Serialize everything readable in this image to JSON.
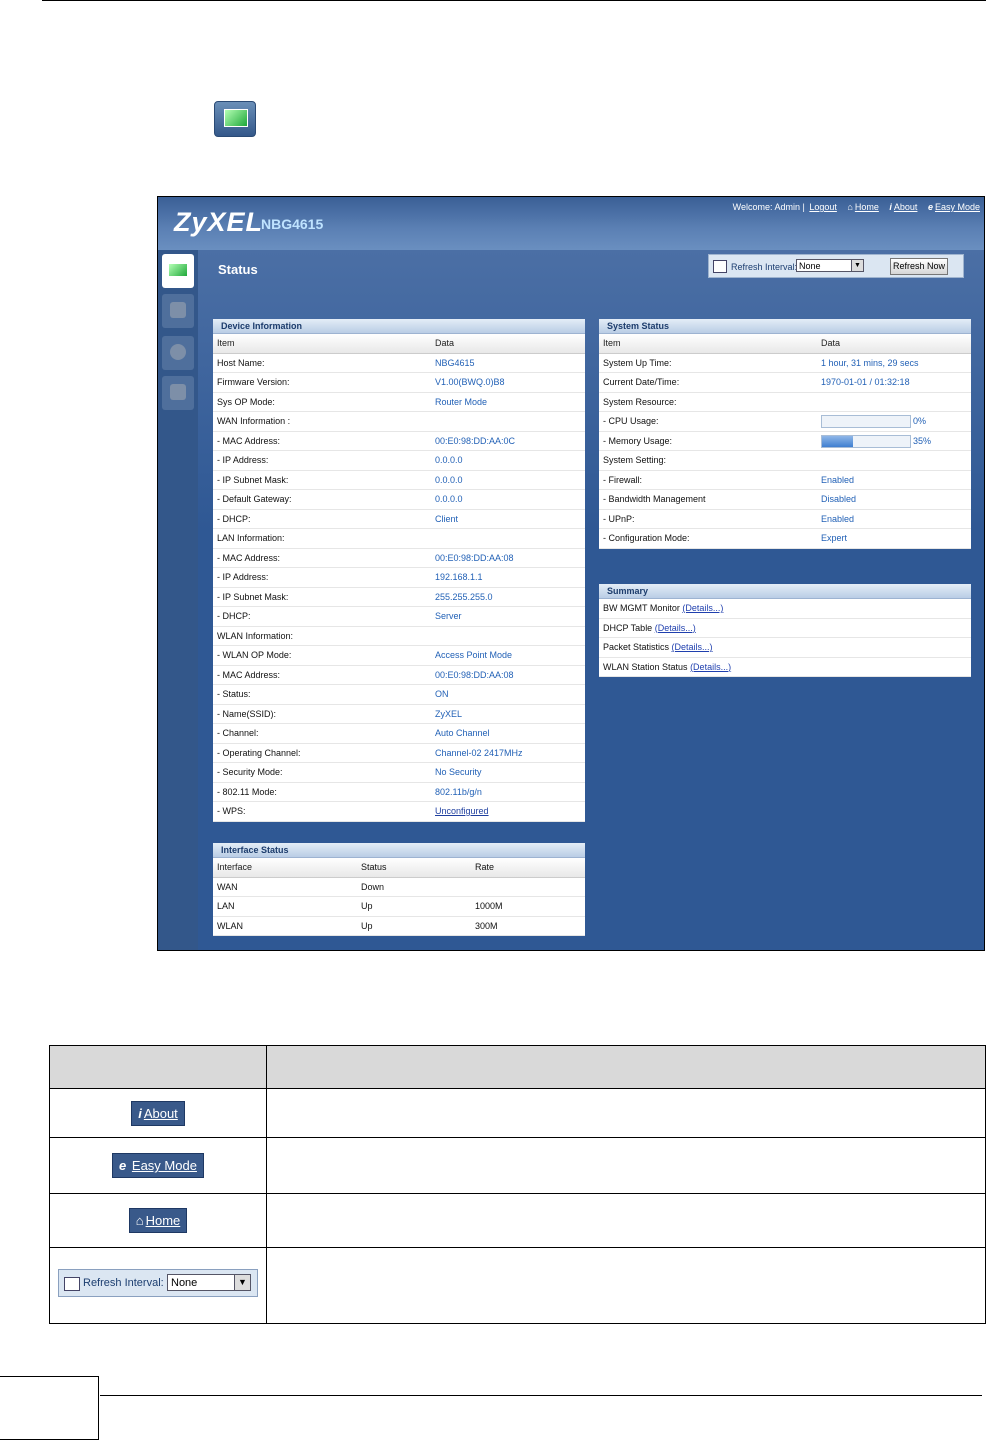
{
  "header": {
    "logo": "ZyXEL",
    "model": "NBG4615",
    "welcome": "Welcome: Admin |",
    "logout": "Logout",
    "home": "Home",
    "about": "About",
    "easy_mode": "Easy Mode"
  },
  "page": {
    "title": "Status",
    "refresh_label": "Refresh Interval:",
    "refresh_value": "None",
    "refresh_button": "Refresh Now"
  },
  "device_info": {
    "title": "Device Information",
    "col_item": "Item",
    "col_data": "Data",
    "rows": [
      {
        "item": "Host Name:",
        "data": "NBG4615"
      },
      {
        "item": "Firmware Version:",
        "data": "V1.00(BWQ.0)B8"
      },
      {
        "item": "Sys OP Mode:",
        "data": "Router Mode"
      },
      {
        "item": "WAN Information :",
        "data": ""
      },
      {
        "item": "- MAC Address:",
        "data": "00:E0:98:DD:AA:0C"
      },
      {
        "item": "- IP Address:",
        "data": "0.0.0.0"
      },
      {
        "item": "- IP Subnet Mask:",
        "data": "0.0.0.0"
      },
      {
        "item": "- Default Gateway:",
        "data": "0.0.0.0"
      },
      {
        "item": "- DHCP:",
        "data": "Client"
      },
      {
        "item": "LAN Information:",
        "data": ""
      },
      {
        "item": "- MAC Address:",
        "data": "00:E0:98:DD:AA:08"
      },
      {
        "item": "- IP Address:",
        "data": "192.168.1.1"
      },
      {
        "item": "- IP Subnet Mask:",
        "data": "255.255.255.0"
      },
      {
        "item": "- DHCP:",
        "data": "Server"
      },
      {
        "item": "WLAN Information:",
        "data": ""
      },
      {
        "item": "- WLAN OP Mode:",
        "data": "Access Point Mode"
      },
      {
        "item": "- MAC Address:",
        "data": "00:E0:98:DD:AA:08"
      },
      {
        "item": "- Status:",
        "data": "ON"
      },
      {
        "item": "- Name(SSID):",
        "data": "ZyXEL"
      },
      {
        "item": "- Channel:",
        "data": "Auto Channel"
      },
      {
        "item": "- Operating Channel:",
        "data": "Channel-02 2417MHz"
      },
      {
        "item": "- Security Mode:",
        "data": "No Security"
      },
      {
        "item": "- 802.11 Mode:",
        "data": "802.11b/g/n"
      },
      {
        "item": "- WPS:",
        "data": "Unconfigured"
      }
    ]
  },
  "system_status": {
    "title": "System Status",
    "col_item": "Item",
    "col_data": "Data",
    "up_time_label": "System Up Time:",
    "up_time": "1 hour, 31 mins, 29 secs",
    "date_label": "Current Date/Time:",
    "date": "1970-01-01 / 01:32:18",
    "resource_label": "System Resource:",
    "cpu_label": "- CPU Usage:",
    "cpu_pct": "0%",
    "cpu_value": 0,
    "mem_label": "- Memory Usage:",
    "mem_pct": "35%",
    "mem_value": 35,
    "setting_label": "System Setting:",
    "firewall_label": "- Firewall:",
    "firewall": "Enabled",
    "bw_label": "- Bandwidth Management",
    "bw": "Disabled",
    "upnp_label": "- UPnP:",
    "upnp": "Enabled",
    "config_label": "- Configuration Mode:",
    "config": "Expert"
  },
  "summary": {
    "title": "Summary",
    "details": "(Details...)",
    "items": [
      "BW MGMT Monitor",
      "DHCP Table",
      "Packet Statistics",
      "WLAN Station Status"
    ]
  },
  "interface_status": {
    "title": "Interface Status",
    "col_interface": "Interface",
    "col_status": "Status",
    "col_rate": "Rate",
    "rows": [
      {
        "iface": "WAN",
        "status": "Down",
        "rate": ""
      },
      {
        "iface": "LAN",
        "status": "Up",
        "rate": "1000M"
      },
      {
        "iface": "WLAN",
        "status": "Up",
        "rate": "300M"
      }
    ]
  },
  "doc_table": {
    "about_label": "About",
    "easy_label": "Easy Mode",
    "home_label": "Home",
    "refresh_label": "Refresh Interval:",
    "refresh_value": "None"
  },
  "colors": {
    "accent": "#2f5894",
    "link": "#2261b6"
  }
}
